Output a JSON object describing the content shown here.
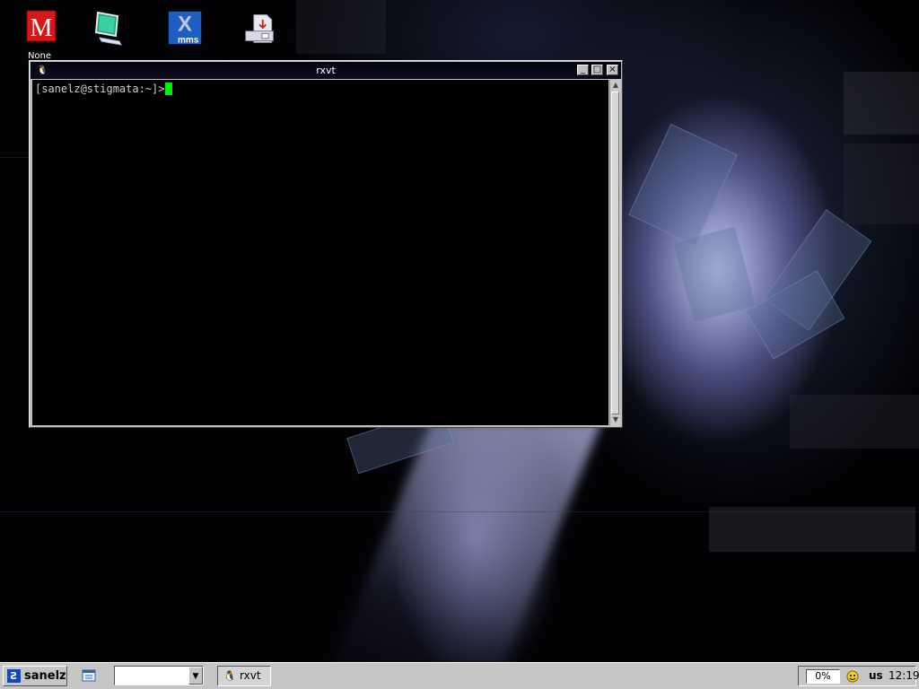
{
  "desktop": {
    "icons": [
      {
        "label": "None",
        "icon": "m-logo-icon"
      },
      {
        "label": "",
        "icon": "monitor-icon"
      },
      {
        "label": "",
        "icon": "xmms-icon"
      },
      {
        "label": "",
        "icon": "install-disk-icon"
      }
    ],
    "xmms_text": "mms"
  },
  "window": {
    "title": "rxvt",
    "title_icon": "tux-icon",
    "buttons": {
      "minimize": "_",
      "maximize": "□",
      "close": "×"
    }
  },
  "terminal": {
    "prompt": "[sanelz@stigmata:~]>",
    "cursor_color": "#00ee00"
  },
  "taskbar": {
    "start_label": "sanelz",
    "start_logo": "Ƨ",
    "combo_value": "",
    "tasks": [
      {
        "label": "rxvt",
        "icon": "tux-icon"
      }
    ],
    "cpu": "0%",
    "keyboard_layout": "us",
    "clock": "12:19"
  }
}
